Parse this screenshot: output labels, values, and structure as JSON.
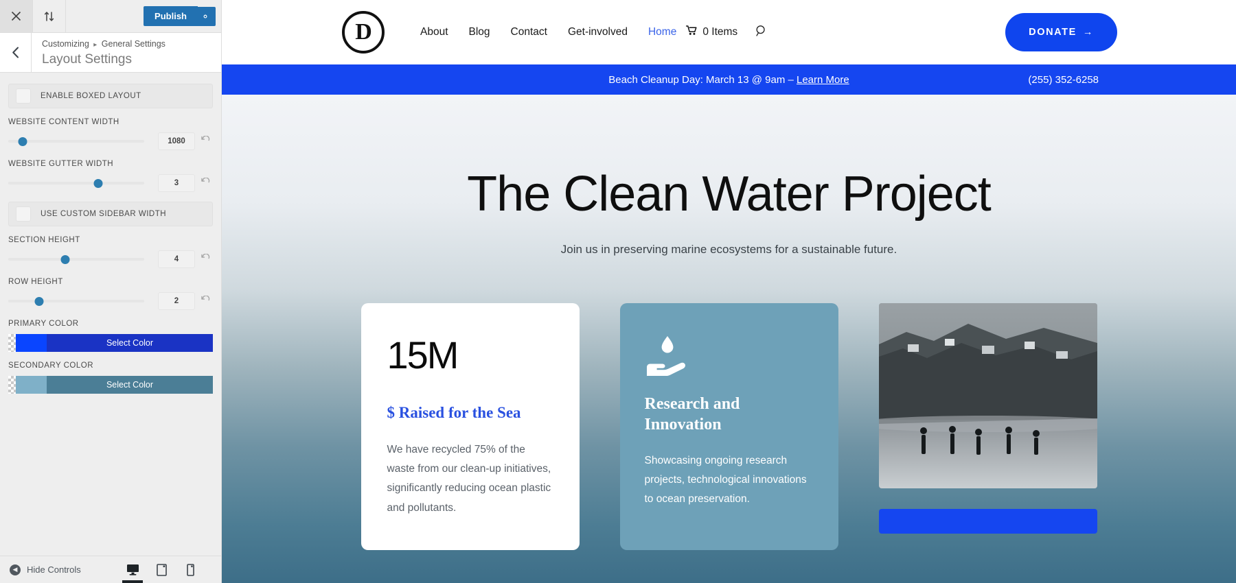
{
  "customizer": {
    "topbar": {
      "close_icon": "close-icon",
      "devices_icon": "sort-arrows-icon",
      "publish_label": "Publish",
      "gear_icon": "gear-icon"
    },
    "header": {
      "back_icon": "chevron-left-icon",
      "breadcrumb_root": "Customizing",
      "breadcrumb_separator": "▸",
      "breadcrumb_section": "General Settings",
      "panel_title": "Layout Settings"
    },
    "controls": [
      {
        "type": "toggle",
        "label": "ENABLE BOXED LAYOUT",
        "checked": false
      },
      {
        "type": "slider",
        "label": "WEBSITE CONTENT WIDTH",
        "value": "1080",
        "percent": 10,
        "reset_icon": "reset-icon"
      },
      {
        "type": "slider",
        "label": "WEBSITE GUTTER WIDTH",
        "value": "3",
        "percent": 62,
        "reset_icon": "reset-icon"
      },
      {
        "type": "toggle",
        "label": "USE CUSTOM SIDEBAR WIDTH",
        "checked": false
      },
      {
        "type": "slider",
        "label": "SECTION HEIGHT",
        "value": "4",
        "percent": 39,
        "reset_icon": "reset-icon"
      },
      {
        "type": "slider",
        "label": "ROW HEIGHT",
        "value": "2",
        "percent": 21,
        "reset_icon": "reset-icon"
      },
      {
        "type": "color",
        "label": "PRIMARY COLOR",
        "button_label": "Select Color",
        "swatch": "#0a45ff",
        "bar": "#1a33c4"
      },
      {
        "type": "color",
        "label": "SECONDARY COLOR",
        "button_label": "Select Color",
        "swatch": "#7fb0c8",
        "bar": "#4b7e96"
      }
    ],
    "footer": {
      "hide_controls_label": "Hide Controls",
      "hide_arrow_icon": "arrow-left-circle-icon",
      "devices": [
        {
          "name": "desktop-preview",
          "icon": "desktop-icon",
          "active": true
        },
        {
          "name": "tablet-preview",
          "icon": "tablet-icon",
          "active": false
        },
        {
          "name": "mobile-preview",
          "icon": "mobile-icon",
          "active": false
        }
      ]
    }
  },
  "site": {
    "logo_letter": "D",
    "nav_links": [
      {
        "label": "About",
        "current": false
      },
      {
        "label": "Blog",
        "current": false
      },
      {
        "label": "Contact",
        "current": false
      },
      {
        "label": "Get-involved",
        "current": false
      },
      {
        "label": "Home",
        "current": true
      }
    ],
    "cart": {
      "icon": "cart-icon",
      "label": "0 Items"
    },
    "search_icon": "search-icon",
    "donate": {
      "label": "DONATE",
      "arrow": "→",
      "color": "#0f45ee"
    },
    "announcement": {
      "text": "Beach Cleanup Day: March 13 @ 9am – ",
      "link_label": "Learn More",
      "phone": "(255) 352-6258",
      "background": "#1546f0"
    },
    "hero": {
      "title": "The Clean Water Project",
      "subtitle": "Join us in preserving marine ecosystems for a sustainable future."
    },
    "cards": [
      {
        "kind": "stat",
        "stat": "15M",
        "stat_label": "$ Raised for the Sea",
        "body": "We have recycled 75% of the waste from our clean-up initiatives, significantly reducing ocean plastic and pollutants."
      },
      {
        "kind": "icon",
        "icon": "water-drop-in-hand-icon",
        "title": "Research and Innovation",
        "body": "Showcasing ongoing research projects, technological innovations to ocean preservation.",
        "background": "#6ea1b8"
      },
      {
        "kind": "photo",
        "image_alt": "beach-coastline-photo"
      }
    ]
  }
}
